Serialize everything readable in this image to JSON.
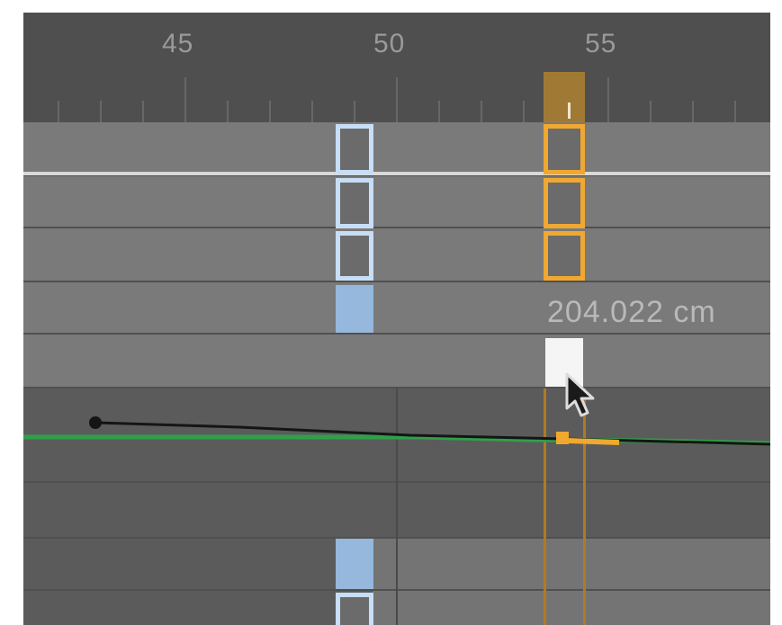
{
  "ruler": {
    "labels": [
      "45",
      "50",
      "55"
    ]
  },
  "readout": {
    "value": "204.022 cm"
  },
  "colors": {
    "current_frame": "#f0a830",
    "selected_keys": "#c7def6",
    "curve": "#2fa04a"
  },
  "icons": {
    "cursor": "mouse-pointer-icon"
  }
}
